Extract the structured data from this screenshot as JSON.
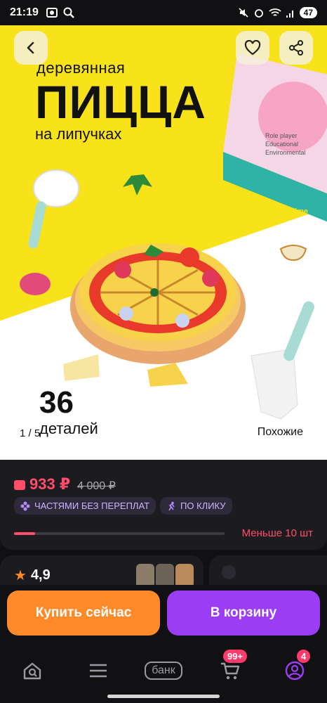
{
  "status_bar": {
    "time": "21:19",
    "battery": "47",
    "icons": [
      "screenshot-icon",
      "search-icon",
      "mute-icon",
      "alarm-icon",
      "wifi-icon",
      "signal-icon",
      "battery-icon"
    ]
  },
  "hero": {
    "caption_top": "деревянная",
    "caption_big": "ПИЦЦА",
    "caption_sub": "на липучках",
    "count": "36",
    "count_label": "деталей",
    "pager": "1 / 5",
    "similar": "Похожие"
  },
  "price": {
    "current": "933 ₽",
    "old": "4 000 ₽",
    "tags": [
      {
        "label": "ЧАСТЯМИ БЕЗ ПЕРЕПЛАТ",
        "icon": "installments-icon"
      },
      {
        "label": "ПО КЛИКУ",
        "icon": "run-icon"
      }
    ],
    "stock_fraction": 0.1,
    "stock_label": "Меньше 10 шт",
    "accent": "#ff4d6a"
  },
  "reviews": {
    "rating": "4,9"
  },
  "actions": {
    "buy_now": "Купить сейчас",
    "to_cart": "В корзину",
    "buy_color": "#ff8a2a",
    "cart_color": "#9b3df5"
  },
  "bottom_nav": {
    "bank_label": "банк",
    "cart_badge": "99+",
    "profile_badge": "4"
  }
}
